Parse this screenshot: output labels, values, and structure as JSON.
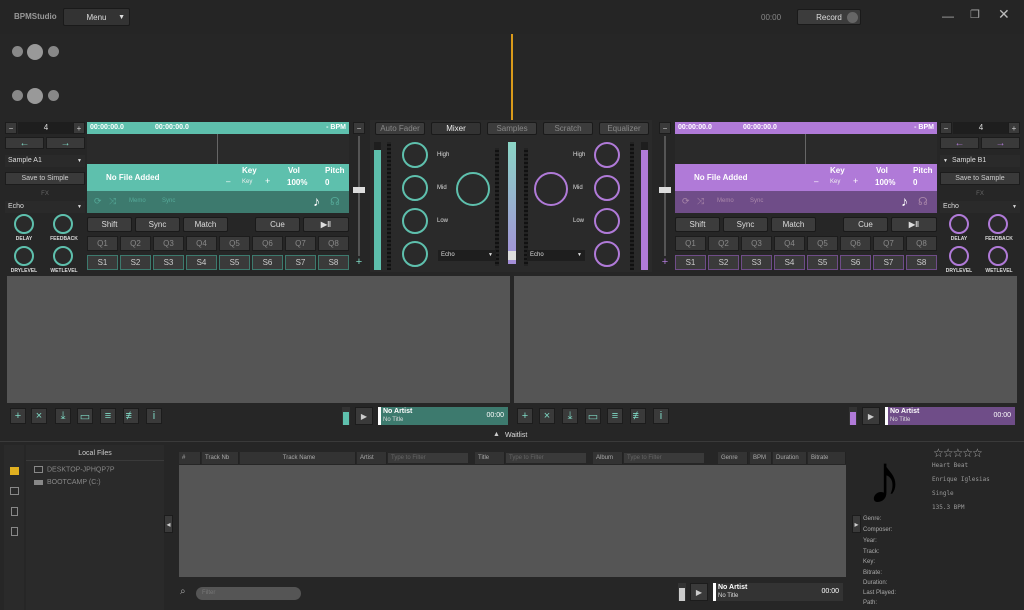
{
  "app": {
    "title": "BPMStudio",
    "menu": "Menu",
    "time": "00:00",
    "record": "Record"
  },
  "deckA": {
    "pitch_val": "4",
    "time1": "00:00:00.0",
    "time2": "00:00:00.0",
    "bpm": "- BPM",
    "sample": "Sample A1",
    "save": "Save to Simple",
    "fx_label": "FX",
    "fx_select": "Echo",
    "title": "No File Added",
    "key_h": "Key",
    "vol_h": "Vol",
    "pitch_h": "Pitch",
    "minus": "–",
    "key": "Key",
    "plus": "+",
    "vol": "100%",
    "pitch": "0",
    "memo": "Memo",
    "sync_tag": "Sync",
    "knob_labels": [
      "DELAY",
      "FEEDBACK",
      "DRYLEVEL",
      "WETLEVEL"
    ],
    "shift": "Shift",
    "sync": "Sync",
    "match": "Match",
    "cue": "Cue",
    "play": "▶‖",
    "q": [
      "Q1",
      "Q2",
      "Q3",
      "Q4",
      "Q5",
      "Q6",
      "Q7",
      "Q8"
    ],
    "s": [
      "S1",
      "S2",
      "S3",
      "S4",
      "S5",
      "S6",
      "S7",
      "S8"
    ]
  },
  "deckB": {
    "pitch_val": "4",
    "time1": "00:00:00.0",
    "time2": "00:00:00.0",
    "bpm": "- BPM",
    "sample": "Sample B1",
    "save": "Save to Sample",
    "fx_label": "FX",
    "fx_select": "Echo",
    "title": "No File Added",
    "key_h": "Key",
    "vol_h": "Vol",
    "pitch_h": "Pitch",
    "minus": "–",
    "key": "Key",
    "plus": "+",
    "vol": "100%",
    "pitch": "0",
    "memo": "Memo",
    "sync_tag": "Sync",
    "knob_labels": [
      "DELAY",
      "FEEDBACK",
      "DRYLEVEL",
      "WETLEVEL"
    ],
    "shift": "Shift",
    "sync": "Sync",
    "match": "Match",
    "cue": "Cue",
    "play": "▶‖",
    "q": [
      "Q1",
      "Q2",
      "Q3",
      "Q4",
      "Q5",
      "Q6",
      "Q7",
      "Q8"
    ],
    "s": [
      "S1",
      "S2",
      "S3",
      "S4",
      "S5",
      "S6",
      "S7",
      "S8"
    ]
  },
  "mixer": {
    "tabs": [
      "Auto Fader",
      "Mixer",
      "Samples",
      "Scratch",
      "Equalizer"
    ],
    "eq": [
      "High",
      "Mid",
      "Low"
    ],
    "eq_right": [
      "High",
      "Mid",
      "Low"
    ],
    "fx_left": "Echo",
    "fx_right": "Echo"
  },
  "players": {
    "a": {
      "artist": "No Artist",
      "title": "No Title",
      "time": "00:00"
    },
    "b": {
      "artist": "No Artist",
      "title": "No Title",
      "time": "00:00"
    },
    "c": {
      "artist": "No Artist",
      "title": "No Title",
      "time": "00:00"
    }
  },
  "waitlist": "Waitlist",
  "browser": {
    "header": "Local Files",
    "items": [
      "DESKTOP-JPHQP7P",
      "BOOTCAMP (C:)"
    ],
    "cols": [
      "#",
      "Track Nb",
      "Track Name",
      "Artist",
      "Title",
      "Album",
      "Genre",
      "BPM",
      "Duration",
      "Bitrate"
    ],
    "filters": [
      "Type to Filter",
      "Type to Filter",
      "Type to Filter"
    ],
    "search": "Filter"
  },
  "trackinfo": {
    "rating": "☆☆☆☆☆",
    "title": "Heart Beat",
    "artist": "Enrique Iglesias",
    "type": "Single",
    "bpm": "135.3 BPM",
    "fields": [
      "Genre:",
      "Composer:",
      "Year:",
      "Track:",
      "Key:",
      "Bitrate:",
      "Duration:",
      "Last Played:",
      "Path:"
    ]
  }
}
